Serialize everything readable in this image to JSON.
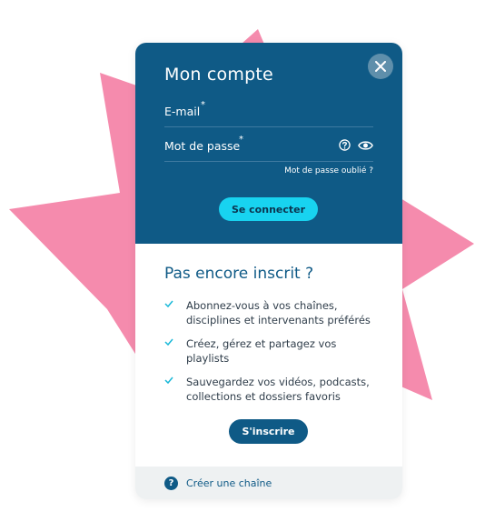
{
  "colors": {
    "primary": "#0f5a86",
    "accent": "#18d3f0",
    "burst": "#f58bad",
    "footer_bg": "#eef1f2"
  },
  "login": {
    "title": "Mon compte",
    "email_label": "E-mail",
    "password_label": "Mot de passe",
    "required_mark": "*",
    "forgot_link": "Mot de passe oublié ?",
    "submit_label": "Se connecter",
    "icons": [
      "close-icon",
      "help-icon",
      "eye-icon"
    ]
  },
  "signup": {
    "title": "Pas encore inscrit ?",
    "benefits": [
      "Abonnez-vous à vos chaînes, disciplines et intervenants préférés",
      "Créez, gérez et partagez vos playlists",
      "Sauvegardez vos vidéos, podcasts, collections et dossiers favoris"
    ],
    "submit_label": "S'inscrire"
  },
  "footer": {
    "help_glyph": "?",
    "link_label": "Créer une chaîne"
  }
}
